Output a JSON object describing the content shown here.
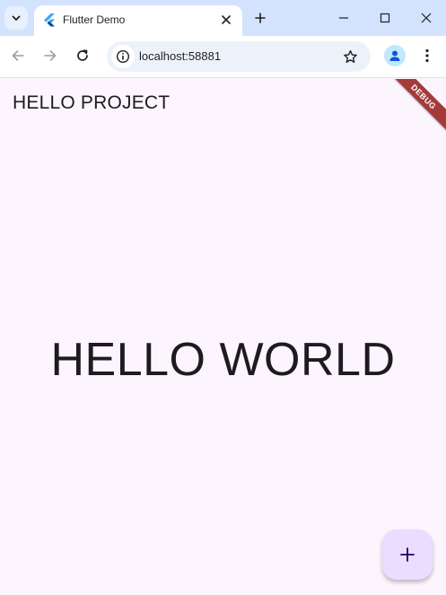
{
  "browser": {
    "tab": {
      "title": "Flutter Demo",
      "favicon": "flutter-logo"
    },
    "address": {
      "url": "localhost:58881"
    },
    "icons": {
      "tab_search": "chevron-down-icon",
      "tab_close": "close-icon",
      "new_tab": "plus-icon",
      "minimize": "minimize-icon",
      "maximize": "maximize-icon",
      "close_window": "close-icon",
      "back": "arrow-left-icon",
      "forward": "arrow-right-icon",
      "reload": "reload-icon",
      "site_info": "info-icon",
      "bookmark": "star-icon",
      "profile": "person-icon",
      "menu": "more-vert-icon"
    }
  },
  "app": {
    "appbar_title": "HELLO PROJECT",
    "body_text": "HELLO WORLD",
    "debug_banner": "DEBUG",
    "fab_icon": "plus-icon"
  },
  "colors": {
    "page_bg": "#fcf5fd",
    "tabstrip_bg": "#d3e3fd",
    "fab_bg": "#eaddff",
    "debug_banner": "#a33b3b",
    "text": "#1d1b20"
  }
}
